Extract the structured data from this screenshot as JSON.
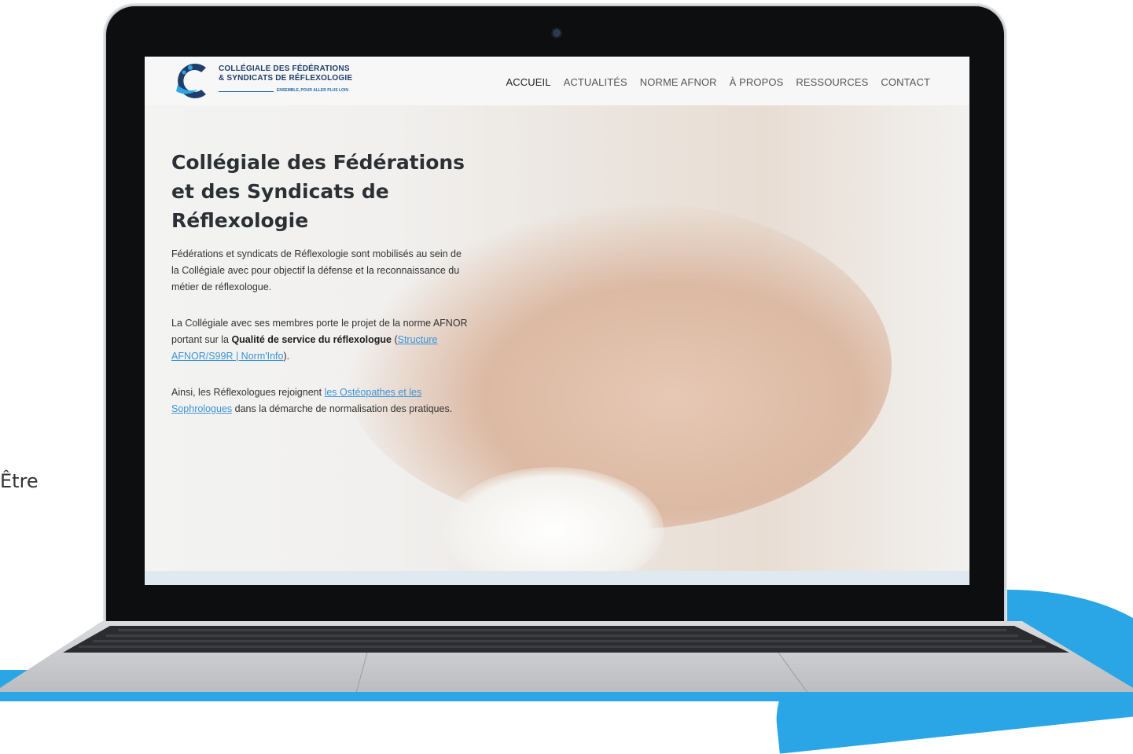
{
  "side": {
    "text": "Être"
  },
  "header": {
    "logo_line1": "COLLÉGIALE DES FÉDÉRATIONS",
    "logo_line2": "& SYNDICATS DE RÉFLEXOLOGIE",
    "logo_tagline": "ENSEMBLE, POUR ALLER PLUS LOIN",
    "nav": [
      "ACCUEIL",
      "ACTUALITÉS",
      "NORME AFNOR",
      "À PROPOS",
      "RESSOURCES",
      "CONTACT"
    ]
  },
  "hero": {
    "title_line1": "Collégiale des Fédérations",
    "title_line2": "et des Syndicats de",
    "title_line3": "Réflexologie",
    "p1": "Fédérations et syndicats de Réflexologie sont mobilisés au sein de la Collégiale avec pour objectif la défense et la reconnaissance du métier de réflexologue.",
    "p2_a": "La Collégiale avec ses membres porte le projet de la norme AFNOR portant sur la ",
    "p2_bold": "Qualité de service du réflexologue",
    "p2_b": " (",
    "p2_link": "Structure AFNOR/S99R | Norm'Info",
    "p2_c": ").",
    "p3_a": "Ainsi, les Réflexologues rejoignent ",
    "p3_link": "les Ostéopathes et les Sophrologues",
    "p3_b": " dans la démarche de normalisation des pratiques."
  },
  "colors": {
    "accent": "#2aa6e6",
    "link": "#3a94d8",
    "navy": "#1f3f6b"
  }
}
